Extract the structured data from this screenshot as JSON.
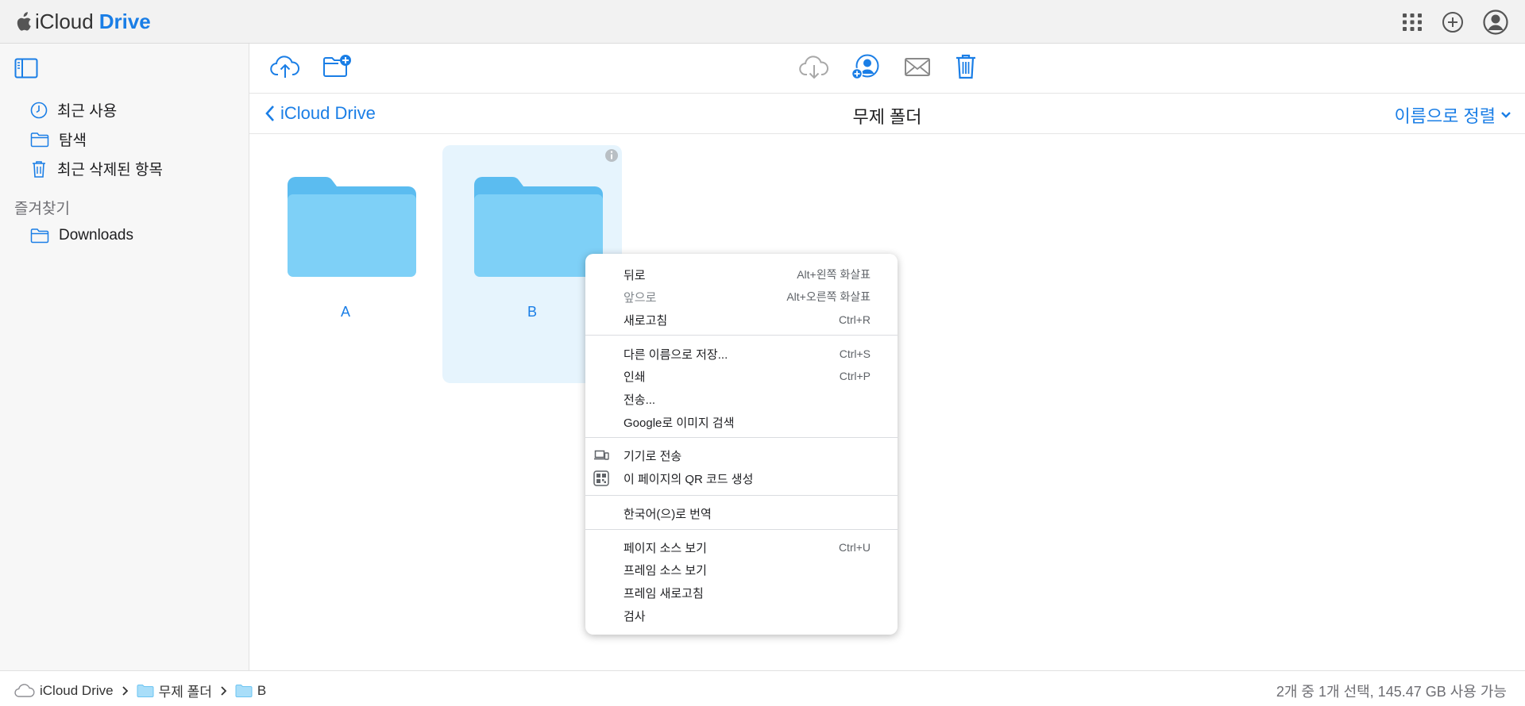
{
  "header": {
    "brand_icloud": "iCloud",
    "brand_drive": "Drive",
    "icons": [
      "apple-logo-icon",
      "app-grid-icon",
      "add-circle-icon",
      "account-icon"
    ]
  },
  "colors": {
    "accent": "#1a7ee6",
    "folder": "#7ed0f7",
    "selected_tile": "#e6f4fd"
  },
  "sidebar": {
    "items": [
      {
        "label": "최근 사용",
        "icon": "clock-icon"
      },
      {
        "label": "탐색",
        "icon": "folder-icon"
      },
      {
        "label": "최근 삭제된 항목",
        "icon": "trash-icon"
      }
    ],
    "favorites_title": "즐겨찾기",
    "favorites": [
      {
        "label": "Downloads",
        "icon": "folder-icon"
      }
    ]
  },
  "toolbar": {
    "icons": [
      "upload-icon",
      "new-folder-icon",
      "download-icon",
      "share-user-icon",
      "mail-icon",
      "trash-icon"
    ]
  },
  "nav": {
    "back_label": "iCloud Drive",
    "title": "무제 폴더",
    "sort_label": "이름으로 정렬"
  },
  "folders": [
    {
      "name": "A",
      "selected": false
    },
    {
      "name": "B",
      "selected": true
    }
  ],
  "context_menu": {
    "groups": [
      [
        {
          "label": "뒤로",
          "shortcut": "Alt+왼쪽 화살표"
        },
        {
          "label": "앞으로",
          "shortcut": "Alt+오른쪽 화살표",
          "disabled": true
        },
        {
          "label": "새로고침",
          "shortcut": "Ctrl+R"
        }
      ],
      [
        {
          "label": "다른 이름으로 저장...",
          "shortcut": "Ctrl+S"
        },
        {
          "label": "인쇄",
          "shortcut": "Ctrl+P"
        },
        {
          "label": "전송...",
          "shortcut": ""
        },
        {
          "label": "Google로 이미지 검색",
          "shortcut": ""
        }
      ],
      [
        {
          "label": "기기로 전송",
          "shortcut": "",
          "icon": "devices-icon"
        },
        {
          "label": "이 페이지의 QR 코드 생성",
          "shortcut": "",
          "icon": "qr-code-icon"
        }
      ],
      [
        {
          "label": "한국어(으)로 번역",
          "shortcut": ""
        }
      ],
      [
        {
          "label": "페이지 소스 보기",
          "shortcut": "Ctrl+U"
        },
        {
          "label": "프레임 소스 보기",
          "shortcut": ""
        },
        {
          "label": "프레임 새로고침",
          "shortcut": ""
        },
        {
          "label": "검사",
          "shortcut": ""
        }
      ]
    ]
  },
  "footer": {
    "breadcrumbs": [
      "iCloud Drive",
      "무제 폴더",
      "B"
    ],
    "status": "2개 중 1개 선택, 145.47 GB 사용 가능"
  }
}
